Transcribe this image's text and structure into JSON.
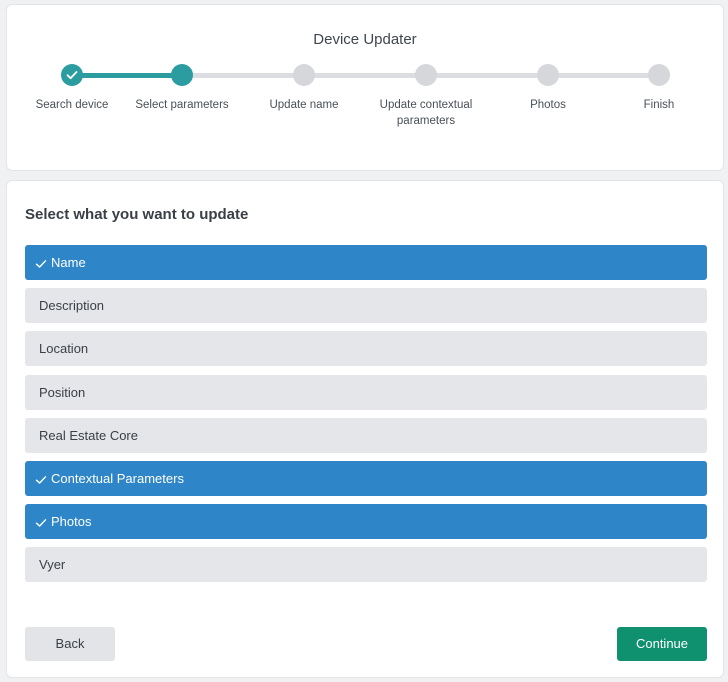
{
  "stepper": {
    "title": "Device Updater",
    "steps": [
      {
        "label": "Search device",
        "state": "complete"
      },
      {
        "label": "Select parameters",
        "state": "current"
      },
      {
        "label": "Update name",
        "state": "pending"
      },
      {
        "label": "Update contextual parameters",
        "state": "pending"
      },
      {
        "label": "Photos",
        "state": "pending"
      },
      {
        "label": "Finish",
        "state": "pending"
      }
    ]
  },
  "options": {
    "title": "Select what you want to update",
    "items": [
      {
        "label": "Name",
        "selected": true
      },
      {
        "label": "Description",
        "selected": false
      },
      {
        "label": "Location",
        "selected": false
      },
      {
        "label": "Position",
        "selected": false
      },
      {
        "label": "Real Estate Core",
        "selected": false
      },
      {
        "label": "Contextual Parameters",
        "selected": true
      },
      {
        "label": "Photos",
        "selected": true
      },
      {
        "label": "Vyer",
        "selected": false
      }
    ]
  },
  "actions": {
    "back_label": "Back",
    "continue_label": "Continue"
  },
  "icons": {
    "step_complete": "check-icon",
    "option_selected": "check-icon"
  },
  "colors": {
    "accent_teal": "#2b9da1",
    "selected_blue": "#2e86c8",
    "continue_green": "#0f9170",
    "pending_gray": "#d6d7db"
  }
}
